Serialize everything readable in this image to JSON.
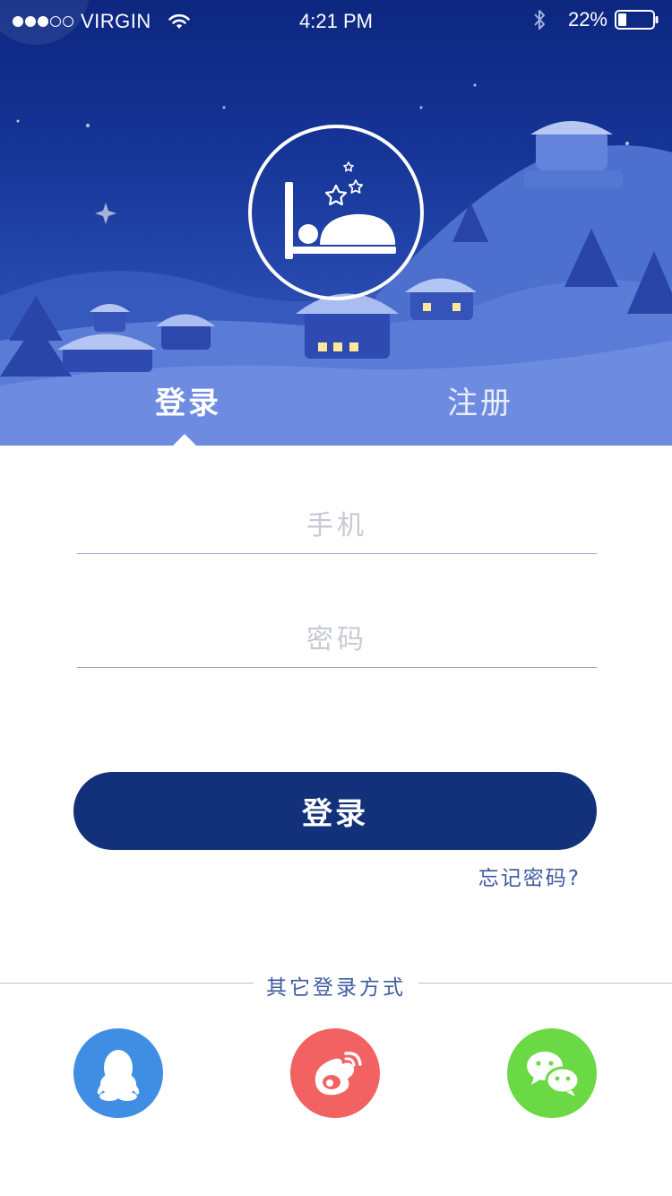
{
  "status_bar": {
    "carrier": "VIRGIN",
    "time": "4:21 PM",
    "battery_percent": "22%",
    "signal_bars_filled": 3,
    "signal_bars_total": 5
  },
  "header": {
    "logo_icon": "sleeping-bed-icon",
    "tabs": [
      {
        "label": "登录",
        "active": true
      },
      {
        "label": "注册",
        "active": false
      }
    ]
  },
  "form": {
    "phone_placeholder": "手机",
    "phone_value": "",
    "password_placeholder": "密码",
    "password_value": "",
    "login_button": "登录",
    "forgot_password": "忘记密码?"
  },
  "other_login": {
    "label": "其它登录方式",
    "providers": [
      {
        "icon": "qq-icon",
        "color": "#3f8ee3"
      },
      {
        "icon": "weibo-icon",
        "color": "#f26262"
      },
      {
        "icon": "wechat-icon",
        "color": "#6bd945"
      }
    ]
  },
  "colors": {
    "primary": "#13317a",
    "link": "#3e5aa0",
    "hero_top": "#0d2780"
  }
}
